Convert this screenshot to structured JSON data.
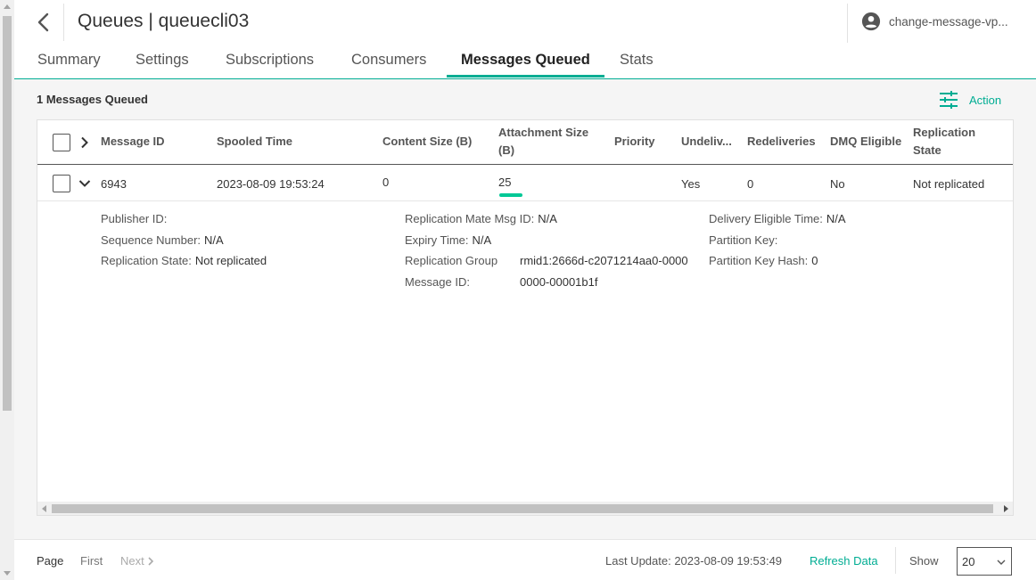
{
  "header": {
    "title": "Queues | queuecli03",
    "user": "change-message-vp..."
  },
  "tabs": [
    {
      "label": "Summary"
    },
    {
      "label": "Settings"
    },
    {
      "label": "Subscriptions"
    },
    {
      "label": "Consumers"
    },
    {
      "label": "Messages Queued"
    },
    {
      "label": "Stats"
    }
  ],
  "active_tab": "Messages Queued",
  "content": {
    "count_label": "1 Messages Queued",
    "action_label": "Action"
  },
  "table": {
    "columns": {
      "message_id": "Message ID",
      "spooled_time": "Spooled Time",
      "content_size": "Content Size (B)",
      "attachment_size_1": "Attachment Size",
      "attachment_size_2": "(B)",
      "priority": "Priority",
      "undelivered": "Undeliv...",
      "redeliveries": "Redeliveries",
      "dmq_eligible": "DMQ Eligible",
      "replication_state_1": "Replication",
      "replication_state_2": "State"
    },
    "rows": [
      {
        "message_id": "6943",
        "spooled_time": "2023-08-09 19:53:24",
        "content_size": "0",
        "attachment_size": "25",
        "priority": "",
        "undelivered": "Yes",
        "redeliveries": "0",
        "dmq_eligible": "No",
        "replication_state": "Not replicated"
      }
    ]
  },
  "details": {
    "publisher_id": {
      "label": "Publisher ID:",
      "value": ""
    },
    "sequence_number": {
      "label": "Sequence Number:",
      "value": "N/A"
    },
    "replication_state": {
      "label": "Replication State:",
      "value": "Not replicated"
    },
    "replication_mate_msg_id": {
      "label": "Replication Mate Msg ID:",
      "value": "N/A"
    },
    "expiry_time": {
      "label": "Expiry Time:",
      "value": "N/A"
    },
    "replication_group": {
      "label": "Replication Group",
      "value": "rmid1:2666d-c2071214aa0-0000"
    },
    "message_id": {
      "label": "Message ID:",
      "value": "0000-00001b1f"
    },
    "delivery_eligible_time": {
      "label": "Delivery Eligible Time:",
      "value": "N/A"
    },
    "partition_key": {
      "label": "Partition Key:",
      "value": ""
    },
    "partition_key_hash": {
      "label": "Partition Key Hash:",
      "value": "0"
    }
  },
  "footer": {
    "page_label": "Page",
    "first_label": "First",
    "next_label": "Next",
    "last_update": "Last Update: 2023-08-09 19:53:49",
    "refresh_label": "Refresh Data",
    "show_label": "Show",
    "show_value": "20"
  },
  "colors": {
    "accent": "#00ad93",
    "attachment_highlight": "#00c896"
  }
}
